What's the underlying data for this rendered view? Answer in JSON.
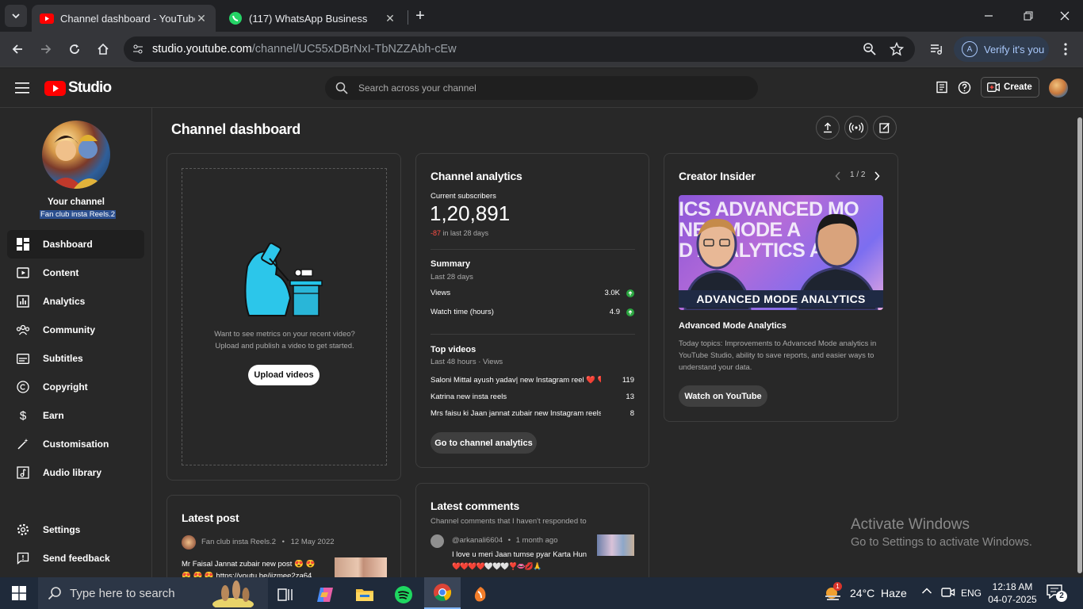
{
  "browser": {
    "tabs": [
      {
        "title": "Channel dashboard - YouTube Studio",
        "active": true
      },
      {
        "title": "(117) WhatsApp Business",
        "active": false
      }
    ],
    "url_host": "studio.youtube.com",
    "url_path": "/channel/UC55xDBrNxI-TbNZZAbh-cEw",
    "verify_label": "Verify it's you",
    "profile_letter": "A"
  },
  "studio": {
    "logo_text": "Studio",
    "search_placeholder": "Search across your channel",
    "create_label": "Create"
  },
  "sidebar": {
    "your_channel": "Your channel",
    "channel_name": "Fan club insta Reels.2",
    "items": [
      {
        "label": "Dashboard",
        "icon": "dashboard-icon"
      },
      {
        "label": "Content",
        "icon": "content-icon"
      },
      {
        "label": "Analytics",
        "icon": "analytics-icon"
      },
      {
        "label": "Community",
        "icon": "community-icon"
      },
      {
        "label": "Subtitles",
        "icon": "subtitles-icon"
      },
      {
        "label": "Copyright",
        "icon": "copyright-icon"
      },
      {
        "label": "Earn",
        "icon": "earn-icon"
      },
      {
        "label": "Customisation",
        "icon": "customisation-icon"
      },
      {
        "label": "Audio library",
        "icon": "audio-library-icon"
      }
    ],
    "bottom_items": [
      {
        "label": "Settings",
        "icon": "settings-icon"
      },
      {
        "label": "Send feedback",
        "icon": "feedback-icon"
      }
    ]
  },
  "dashboard": {
    "title": "Channel dashboard",
    "upload_card": {
      "text_line1": "Want to see metrics on your recent video?",
      "text_line2": "Upload and publish a video to get started.",
      "button": "Upload videos"
    },
    "analytics": {
      "title": "Channel analytics",
      "subs_label": "Current subscribers",
      "subs_value": "1,20,891",
      "subs_change": "-87",
      "subs_change_suffix": "in last 28 days",
      "summary_title": "Summary",
      "summary_period": "Last 28 days",
      "summary_rows": [
        {
          "label": "Views",
          "value": "3.0K"
        },
        {
          "label": "Watch time (hours)",
          "value": "4.9"
        }
      ],
      "top_title": "Top videos",
      "top_period": "Last 48 hours · Views",
      "top_videos": [
        {
          "title": "Saloni Mittal ayush yadav| new Instagram reel ❤️ ❤️...",
          "views": "119"
        },
        {
          "title": "Katrina new insta reels",
          "views": "13"
        },
        {
          "title": "Mrs faisu ki Jaan jannat zubair new Instagram reels l...",
          "views": "8"
        }
      ],
      "button": "Go to channel analytics"
    },
    "insider": {
      "title": "Creator Insider",
      "pager": "1 / 2",
      "thumb_text_top": "ICS ADVANCED MO",
      "thumb_text_mid": "NED MODE A",
      "thumb_text_mid2": "D ANALYTICS AD",
      "thumb_banner": "ADVANCED MODE ANALYTICS",
      "video_title": "Advanced Mode Analytics",
      "desc": "Today topics: Improvements to Advanced Mode analytics in YouTube Studio, ability to save reports, and easier ways to understand your data.",
      "button": "Watch on YouTube"
    },
    "latest_post": {
      "title": "Latest post",
      "author": "Fan club insta Reels.2",
      "date": "12 May 2022",
      "text_line1": "Mr Faisal Jannat zubair new post 😍 😍",
      "text_line2": "😍 😍 😍 https://youtu.be/iizmee2za64"
    },
    "latest_comments": {
      "title": "Latest comments",
      "subtitle": "Channel comments that I haven't responded to",
      "author": "@arkanali6604",
      "age": "1 month ago",
      "text_line1": "I love u meri Jaan tumse pyar Karta Hun",
      "text_line2": "❤️❤️❤️❤️🤍🤍🤍❣️👄💋🙏"
    }
  },
  "watermark": {
    "line1": "Activate Windows",
    "line2": "Go to Settings to activate Windows."
  },
  "taskbar": {
    "search_placeholder": "Type here to search",
    "weather": "24°C  Haze",
    "weather_badge": "1",
    "lang": "ENG",
    "time": "12:18 AM",
    "date": "04-07-2025",
    "notif_count": "2"
  },
  "colors": {
    "youtube_red": "#ff0000",
    "accent_green": "#2ba640",
    "negative_red": "#ff4e45",
    "highlight": "#2b4f8f"
  }
}
